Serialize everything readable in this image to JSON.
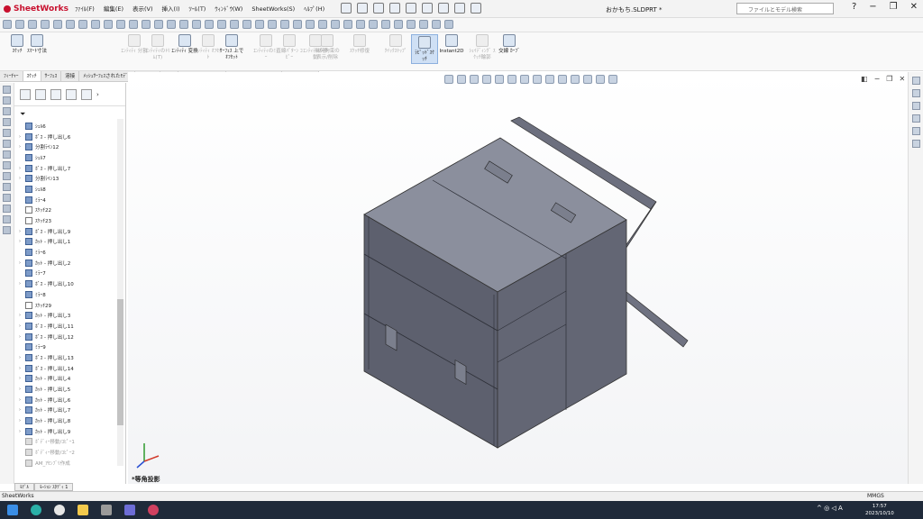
{
  "app": {
    "name": "SheetWorks",
    "document_title": "おかもち.SLDPRT *",
    "menus": [
      "ﾌｧｲﾙ(F)",
      "編集(E)",
      "表示(V)",
      "挿入(I)",
      "ﾂｰﾙ(T)",
      "ｳｨﾝﾄﾞｳ(W)",
      "SheetWorks(S)",
      "ﾍﾙﾌﾟ(H)"
    ],
    "search_placeholder": "ファイルとモデル検索",
    "window_controls": [
      "?",
      "−",
      "❐",
      "✕"
    ]
  },
  "ribbon": {
    "groups": [
      {
        "label": "ｽｹｯﾁ",
        "state": "normal"
      },
      {
        "label": "ｽﾏｰﾄ寸法",
        "state": "normal"
      },
      {
        "label": "ｴﾝﾃｨﾃｨ 分割",
        "state": "dim"
      },
      {
        "label": "ｴﾝﾃｨﾃｨのﾄﾘﾑ(T)",
        "state": "dim"
      },
      {
        "label": "ｴﾝﾃｨﾃｨ 変換",
        "state": "normal"
      },
      {
        "label": "ｴﾝﾃｨﾃｨ ｵﾌｾｯﾄ",
        "state": "dim"
      },
      {
        "label": "ｻｰﾌｪｽ 上で ｵﾌｾｯﾄ",
        "state": "normal"
      },
      {
        "label": "ｴﾝﾃｨﾃｨのﾐﾗｰ",
        "state": "dim"
      },
      {
        "label": "直線ﾊﾟﾀｰﾝ ｺﾋﾟｰ",
        "state": "dim"
      },
      {
        "label": "ｴﾝﾃｨﾃｨの移動",
        "state": "dim"
      },
      {
        "label": "幾何拘束の 表示/削除",
        "state": "dim"
      },
      {
        "label": "ｽｹｯﾁ修復",
        "state": "dim"
      },
      {
        "label": "ｸｲｯｸｽﾅｯﾌﾟ",
        "state": "dim"
      },
      {
        "label": "ﾗﾋﾟｯﾄﾞｽｹｯﾁ",
        "state": "selected"
      },
      {
        "label": "Instant2D",
        "state": "normal"
      },
      {
        "label": "ｼｪｲﾃﾞｨﾝｸﾞ ｽｹｯﾁ輪郭",
        "state": "dim"
      },
      {
        "label": "交線 ｶｰﾌﾞ",
        "state": "normal"
      }
    ]
  },
  "tabs": [
    "ﾌｨｰﾁｬｰ",
    "ｽｹｯﾁ",
    "ｻｰﾌｪｽ",
    "溶接",
    "ﾒｯｼｭｻｰﾌｪｽされたﾓﾃﾞﾙ",
    "ﾏｰｸｱｯﾌﾟ",
    "評価",
    "MBD Dimension",
    "SOLIDWORKS ｱﾄﾞｲﾝ",
    "SheetWorks"
  ],
  "active_tab": 1,
  "feature_tree": [
    {
      "label": "ｼｪﾙ6",
      "kind": "feature",
      "expand": false,
      "grey": false
    },
    {
      "label": "ﾎﾞｽ - 押し出し6",
      "kind": "feature",
      "expand": true,
      "grey": false
    },
    {
      "label": "分割ﾗｲﾝ12",
      "kind": "feature",
      "expand": true,
      "grey": false
    },
    {
      "label": "ｼｪﾙ7",
      "kind": "feature",
      "expand": false,
      "grey": false
    },
    {
      "label": "ﾎﾞｽ - 押し出し7",
      "kind": "feature",
      "expand": true,
      "grey": false
    },
    {
      "label": "分割ﾗｲﾝ13",
      "kind": "feature",
      "expand": true,
      "grey": false
    },
    {
      "label": "ｼｪﾙ8",
      "kind": "feature",
      "expand": false,
      "grey": false
    },
    {
      "label": "ﾐﾗｰ4",
      "kind": "feature",
      "expand": false,
      "grey": false
    },
    {
      "label": "ｽｹｯﾁ22",
      "kind": "sketch",
      "expand": false,
      "grey": false
    },
    {
      "label": "ｽｹｯﾁ23",
      "kind": "sketch",
      "expand": false,
      "grey": false
    },
    {
      "label": "ﾎﾞｽ - 押し出し9",
      "kind": "feature",
      "expand": true,
      "grey": false
    },
    {
      "label": "ｶｯﾄ - 押し出し1",
      "kind": "feature",
      "expand": true,
      "grey": false
    },
    {
      "label": "ﾐﾗｰ6",
      "kind": "feature",
      "expand": false,
      "grey": false
    },
    {
      "label": "ｶｯﾄ - 押し出し2",
      "kind": "feature",
      "expand": true,
      "grey": false
    },
    {
      "label": "ﾐﾗｰ7",
      "kind": "feature",
      "expand": false,
      "grey": false
    },
    {
      "label": "ﾎﾞｽ - 押し出し10",
      "kind": "feature",
      "expand": true,
      "grey": false
    },
    {
      "label": "ﾐﾗｰ8",
      "kind": "feature",
      "expand": false,
      "grey": false
    },
    {
      "label": "ｽｹｯﾁ29",
      "kind": "sketch",
      "expand": false,
      "grey": false
    },
    {
      "label": "ｶｯﾄ - 押し出し3",
      "kind": "feature",
      "expand": true,
      "grey": false
    },
    {
      "label": "ﾎﾞｽ - 押し出し11",
      "kind": "feature",
      "expand": true,
      "grey": false
    },
    {
      "label": "ﾎﾞｽ - 押し出し12",
      "kind": "feature",
      "expand": true,
      "grey": false
    },
    {
      "label": "ﾐﾗｰ9",
      "kind": "feature",
      "expand": false,
      "grey": false
    },
    {
      "label": "ﾎﾞｽ - 押し出し13",
      "kind": "feature",
      "expand": true,
      "grey": false
    },
    {
      "label": "ﾎﾞｽ - 押し出し14",
      "kind": "feature",
      "expand": true,
      "grey": false
    },
    {
      "label": "ｶｯﾄ - 押し出し4",
      "kind": "feature",
      "expand": true,
      "grey": false
    },
    {
      "label": "ｶｯﾄ - 押し出し5",
      "kind": "feature",
      "expand": true,
      "grey": false
    },
    {
      "label": "ｶｯﾄ - 押し出し6",
      "kind": "feature",
      "expand": true,
      "grey": false
    },
    {
      "label": "ｶｯﾄ - 押し出し7",
      "kind": "feature",
      "expand": true,
      "grey": false
    },
    {
      "label": "ｶｯﾄ - 押し出し8",
      "kind": "feature",
      "expand": true,
      "grey": false
    },
    {
      "label": "ｶｯﾄ - 押し出し9",
      "kind": "feature",
      "expand": true,
      "grey": false
    },
    {
      "label": "ﾎﾞﾃﾞｨｰ移動/ｺﾋﾟｰ1",
      "kind": "feature",
      "expand": false,
      "grey": true
    },
    {
      "label": "ﾎﾞﾃﾞｨｰ移動/ｺﾋﾟｰ2",
      "kind": "feature",
      "expand": false,
      "grey": true
    },
    {
      "label": "AM_ｱｾﾝﾌﾞﾘ作成",
      "kind": "feature",
      "expand": false,
      "grey": true
    }
  ],
  "bottom_tabs": [
    "ﾓﾃﾞﾙ",
    "ﾓｰｼｮﾝ ｽﾀﾃﾞｨ 1"
  ],
  "view_label": "*等角投影",
  "status": {
    "left": "SheetWorks",
    "units": "MMGS"
  },
  "clock": {
    "time": "17:57",
    "date": "2023/10/10"
  },
  "colors": {
    "body": "#5e6170",
    "body_top": "#8a8e9c",
    "accent": "#c8102e"
  }
}
